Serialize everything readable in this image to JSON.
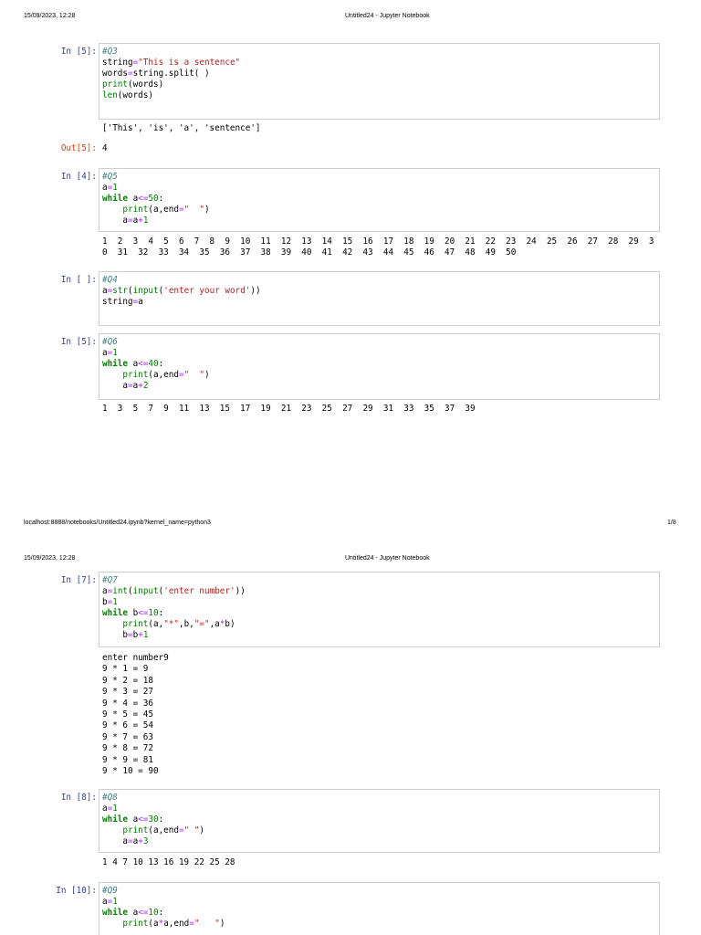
{
  "pages": [
    {
      "date": "15/09/2023, 12:28",
      "title": "Untitled24 - Jupyter Notebook",
      "url": "localhost:8888/notebooks/Untitled24.ipynb?kernel_name=python3",
      "page_num": "1/8"
    },
    {
      "date": "15/09/2023, 12:28",
      "title": "Untitled24 - Jupyter Notebook"
    }
  ],
  "cells": [
    {
      "prompt": "In [5]:",
      "code": [
        [
          [
            "#Q3",
            "c"
          ]
        ],
        [
          [
            "string",
            "p"
          ],
          [
            "=",
            "o"
          ],
          [
            "\"This is a sentence\"",
            "s"
          ]
        ],
        [
          [
            "words",
            "p"
          ],
          [
            "=",
            "o"
          ],
          [
            "string.split( )",
            "p"
          ]
        ],
        [
          [
            "print",
            "k"
          ],
          [
            "(words)",
            "p"
          ]
        ],
        [
          [
            "len",
            "k"
          ],
          [
            "(words)",
            "p"
          ]
        ]
      ],
      "stdout": [
        "['This', 'is', 'a', 'sentence']"
      ],
      "out_prompt": "Out[5]:",
      "out_value": "4"
    },
    {
      "prompt": "In [4]:",
      "code": [
        [
          [
            "#Q5",
            "c"
          ]
        ],
        [
          [
            "a",
            "p"
          ],
          [
            "=",
            "o"
          ],
          [
            "1",
            "n"
          ]
        ],
        [
          [
            "while",
            "kb"
          ],
          [
            " a",
            "p"
          ],
          [
            "<=",
            "o"
          ],
          [
            "50",
            "n"
          ],
          [
            ":",
            "p"
          ]
        ],
        [
          [
            "    ",
            "p"
          ],
          [
            "print",
            "k"
          ],
          [
            "(a,end",
            "p"
          ],
          [
            "=",
            "o"
          ],
          [
            "\"  \"",
            "s"
          ],
          [
            ")",
            "p"
          ]
        ],
        [
          [
            "    a",
            "p"
          ],
          [
            "=",
            "o"
          ],
          [
            "a",
            "p"
          ],
          [
            "+",
            "o"
          ],
          [
            "1",
            "n"
          ]
        ]
      ],
      "stdout": [
        "1  2  3  4  5  6  7  8  9  10  11  12  13  14  15  16  17  18  19  20  21  22  23  24  25  26  27  28  29  3",
        "0  31  32  33  34  35  36  37  38  39  40  41  42  43  44  45  46  47  48  49  50"
      ]
    },
    {
      "prompt": "In [ ]:",
      "code": [
        [
          [
            "#Q4",
            "c"
          ]
        ],
        [
          [
            "a",
            "p"
          ],
          [
            "=",
            "o"
          ],
          [
            "str",
            "k"
          ],
          [
            "(",
            "p"
          ],
          [
            "input",
            "k"
          ],
          [
            "(",
            "p"
          ],
          [
            "'enter your word'",
            "s"
          ],
          [
            "))",
            "p"
          ]
        ],
        [
          [
            "string",
            "p"
          ],
          [
            "=",
            "o"
          ],
          [
            "a",
            "p"
          ]
        ]
      ],
      "stdout": []
    },
    {
      "prompt": "In [5]:",
      "code": [
        [
          [
            "#Q6",
            "c"
          ]
        ],
        [
          [
            "a",
            "p"
          ],
          [
            "=",
            "o"
          ],
          [
            "1",
            "n"
          ]
        ],
        [
          [
            "while",
            "kb"
          ],
          [
            " a",
            "p"
          ],
          [
            "<=",
            "o"
          ],
          [
            "40",
            "n"
          ],
          [
            ":",
            "p"
          ]
        ],
        [
          [
            "    ",
            "p"
          ],
          [
            "print",
            "k"
          ],
          [
            "(a,end",
            "p"
          ],
          [
            "=",
            "o"
          ],
          [
            "\"  \"",
            "s"
          ],
          [
            ")",
            "p"
          ]
        ],
        [
          [
            "    a",
            "p"
          ],
          [
            "=",
            "o"
          ],
          [
            "a",
            "p"
          ],
          [
            "+",
            "o"
          ],
          [
            "2",
            "n"
          ]
        ]
      ],
      "stdout": [
        "1  3  5  7  9  11  13  15  17  19  21  23  25  27  29  31  33  35  37  39"
      ]
    },
    {
      "prompt": "In [7]:",
      "code": [
        [
          [
            "#Q7",
            "c"
          ]
        ],
        [
          [
            "a",
            "p"
          ],
          [
            "=",
            "o"
          ],
          [
            "int",
            "k"
          ],
          [
            "(",
            "p"
          ],
          [
            "input",
            "k"
          ],
          [
            "(",
            "p"
          ],
          [
            "'enter number'",
            "s"
          ],
          [
            "))",
            "p"
          ]
        ],
        [
          [
            "b",
            "p"
          ],
          [
            "=",
            "o"
          ],
          [
            "1",
            "n"
          ]
        ],
        [
          [
            "while",
            "kb"
          ],
          [
            " b",
            "p"
          ],
          [
            "<=",
            "o"
          ],
          [
            "10",
            "n"
          ],
          [
            ":",
            "p"
          ]
        ],
        [
          [
            "    ",
            "p"
          ],
          [
            "print",
            "k"
          ],
          [
            "(a,",
            "p"
          ],
          [
            "\"*\"",
            "s"
          ],
          [
            ",b,",
            "p"
          ],
          [
            "\"=\"",
            "s"
          ],
          [
            ",a",
            "p"
          ],
          [
            "*",
            "o"
          ],
          [
            "b)",
            "p"
          ]
        ],
        [
          [
            "    b",
            "p"
          ],
          [
            "=",
            "o"
          ],
          [
            "b",
            "p"
          ],
          [
            "+",
            "o"
          ],
          [
            "1",
            "n"
          ]
        ]
      ],
      "stdout": [
        "enter number9",
        "9 * 1 = 9",
        "9 * 2 = 18",
        "9 * 3 = 27",
        "9 * 4 = 36",
        "9 * 5 = 45",
        "9 * 6 = 54",
        "9 * 7 = 63",
        "9 * 8 = 72",
        "9 * 9 = 81",
        "9 * 10 = 90"
      ]
    },
    {
      "prompt": "In [8]:",
      "code": [
        [
          [
            "#Q8",
            "c"
          ]
        ],
        [
          [
            "a",
            "p"
          ],
          [
            "=",
            "o"
          ],
          [
            "1",
            "n"
          ]
        ],
        [
          [
            "while",
            "kb"
          ],
          [
            " a",
            "p"
          ],
          [
            "<=",
            "o"
          ],
          [
            "30",
            "n"
          ],
          [
            ":",
            "p"
          ]
        ],
        [
          [
            "    ",
            "p"
          ],
          [
            "print",
            "k"
          ],
          [
            "(a,end",
            "p"
          ],
          [
            "=",
            "o"
          ],
          [
            "\" \"",
            "s"
          ],
          [
            ")",
            "p"
          ]
        ],
        [
          [
            "    a",
            "p"
          ],
          [
            "=",
            "o"
          ],
          [
            "a",
            "p"
          ],
          [
            "+",
            "o"
          ],
          [
            "3",
            "n"
          ]
        ]
      ],
      "stdout": [
        "1 4 7 10 13 16 19 22 25 28"
      ]
    },
    {
      "prompt": "In [10]:",
      "code": [
        [
          [
            "#Q9",
            "c"
          ]
        ],
        [
          [
            "a",
            "p"
          ],
          [
            "=",
            "o"
          ],
          [
            "1",
            "n"
          ]
        ],
        [
          [
            "while",
            "kb"
          ],
          [
            " a",
            "p"
          ],
          [
            "<=",
            "o"
          ],
          [
            "10",
            "n"
          ],
          [
            ":",
            "p"
          ]
        ],
        [
          [
            "    ",
            "p"
          ],
          [
            "print",
            "k"
          ],
          [
            "(a",
            "p"
          ],
          [
            "*",
            "o"
          ],
          [
            "a,end",
            "p"
          ],
          [
            "=",
            "o"
          ],
          [
            "\"   \"",
            "s"
          ],
          [
            ")",
            "p"
          ]
        ]
      ],
      "stdout": []
    }
  ]
}
